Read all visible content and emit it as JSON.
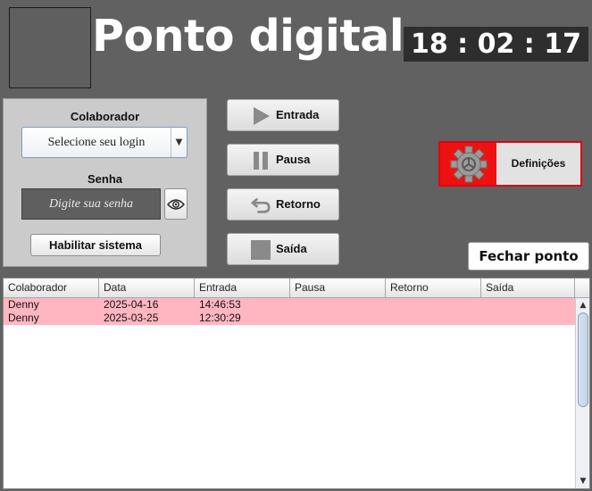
{
  "app": {
    "title": "Ponto digital",
    "clock": "18 : 02 : 17"
  },
  "login": {
    "colaborador_label": "Colaborador",
    "login_select_value": "Selecione seu login",
    "senha_label": "Senha",
    "password_placeholder": "Digite sua senha",
    "habilitar_label": "Habilitar sistema"
  },
  "actions": {
    "entrada": "Entrada",
    "pausa": "Pausa",
    "retorno": "Retorno",
    "saida": "Saída"
  },
  "settings": {
    "definicoes_label": "Definições",
    "fechar_label": "Fechar ponto"
  },
  "colors": {
    "background": "#616161",
    "row_highlight": "#ffb6c1",
    "definicoes_accent": "#ee1111"
  },
  "table": {
    "columns": [
      "Colaborador",
      "Data",
      "Entrada",
      "Pausa",
      "Retorno",
      "Saída"
    ],
    "rows": [
      [
        "Denny",
        "2025-04-16",
        "14:46:53",
        "",
        "",
        ""
      ],
      [
        "Denny",
        "2025-03-25",
        "12:30:29",
        "",
        "",
        ""
      ]
    ]
  },
  "icons": {
    "entrada": "play-icon",
    "pausa": "pause-icon",
    "retorno": "return-arrow-icon",
    "saida": "stop-icon",
    "definicoes": "gear-icon",
    "show_password": "eye-icon"
  }
}
